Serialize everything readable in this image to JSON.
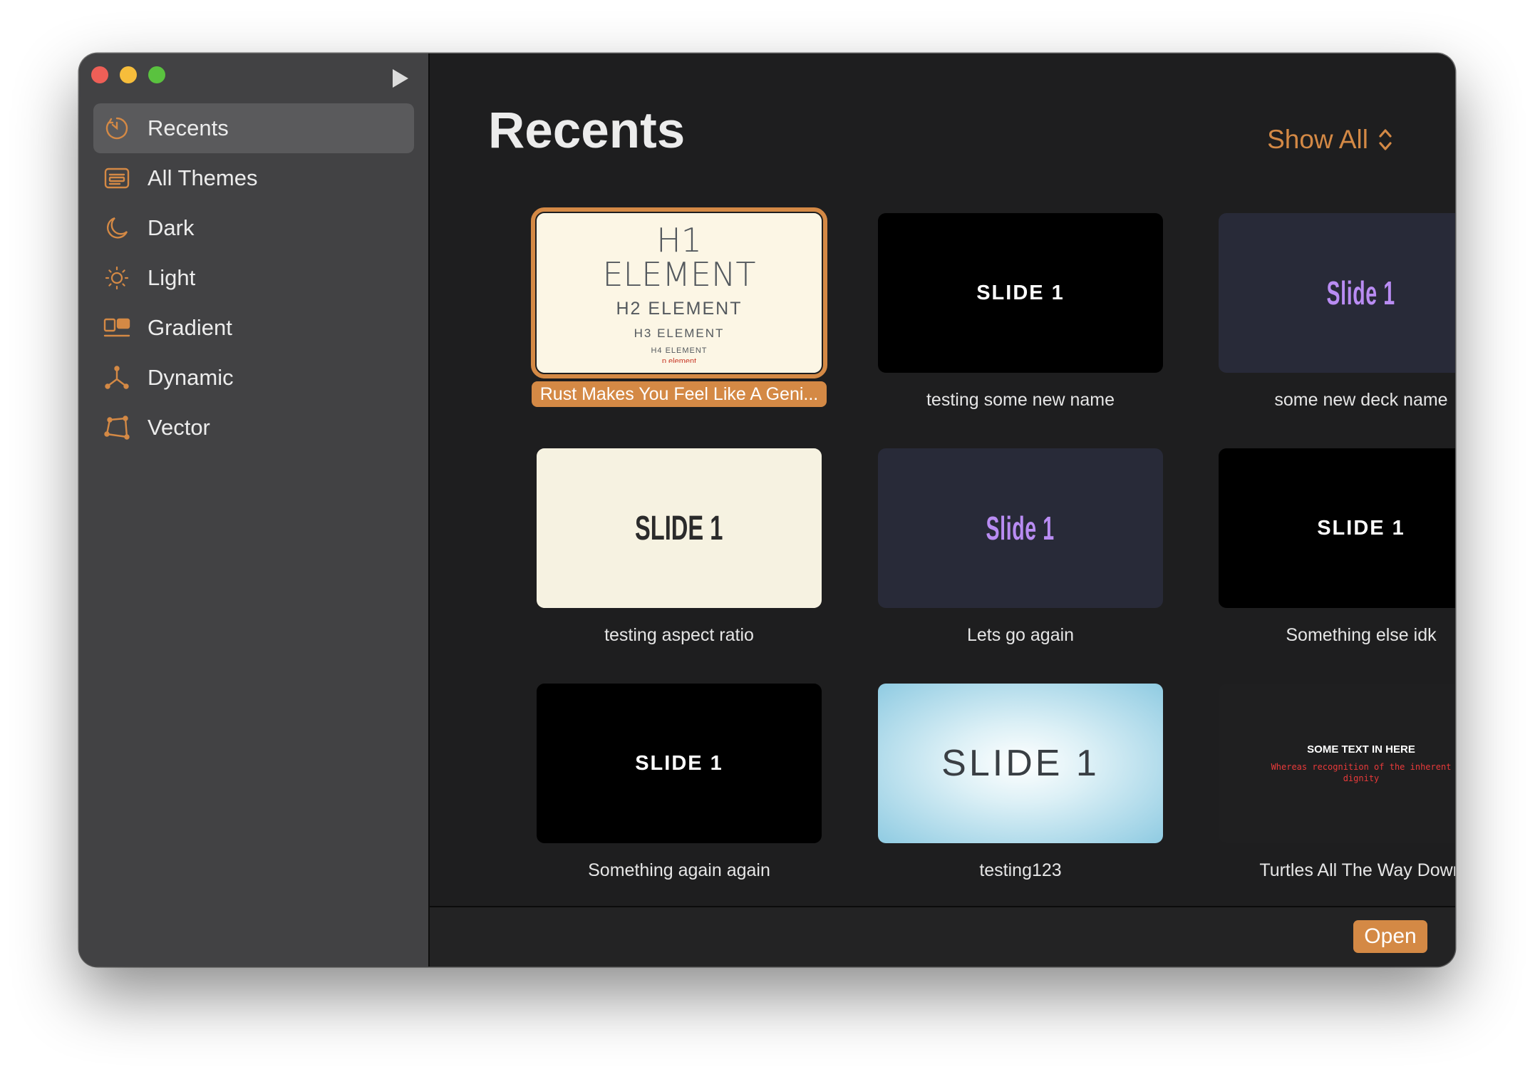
{
  "window": {
    "accent_color": "#d48945"
  },
  "sidebar": {
    "items": [
      {
        "label": "Recents",
        "icon": "clock-icon",
        "active": true
      },
      {
        "label": "All Themes",
        "icon": "themes-icon"
      },
      {
        "label": "Dark",
        "icon": "moon-icon"
      },
      {
        "label": "Light",
        "icon": "sun-icon"
      },
      {
        "label": "Gradient",
        "icon": "gradient-icon"
      },
      {
        "label": "Dynamic",
        "icon": "dynamic-icon"
      },
      {
        "label": "Vector",
        "icon": "vector-icon"
      }
    ]
  },
  "main": {
    "title": "Recents",
    "show_all_label": "Show All",
    "decks": [
      {
        "name": "Rust Makes You Feel Like A Geni...",
        "selected": true,
        "thumb": {
          "h1": "H1 ELEMENT",
          "h2": "H2 ELEMENT",
          "h3": "H3 ELEMENT",
          "h4": "H4 ELEMENT",
          "p": "p element"
        }
      },
      {
        "name": "testing some new name",
        "thumb": {
          "text": "SLIDE 1"
        }
      },
      {
        "name": "some new deck name",
        "thumb": {
          "text": "Slide 1"
        }
      },
      {
        "name": "testing aspect ratio",
        "thumb": {
          "text": "SLIDE 1"
        }
      },
      {
        "name": "Lets go again",
        "thumb": {
          "text": "Slide 1"
        }
      },
      {
        "name": "Something else idk",
        "thumb": {
          "text": "SLIDE 1"
        }
      },
      {
        "name": "Something again again",
        "thumb": {
          "text": "SLIDE 1"
        }
      },
      {
        "name": "testing123",
        "thumb": {
          "text": "SLIDE 1"
        }
      },
      {
        "name": "Turtles All The Way Down",
        "thumb": {
          "title": "SOME TEXT IN HERE",
          "body": "Whereas recognition of the inherent dignity"
        }
      }
    ]
  },
  "footer": {
    "open_label": "Open"
  }
}
